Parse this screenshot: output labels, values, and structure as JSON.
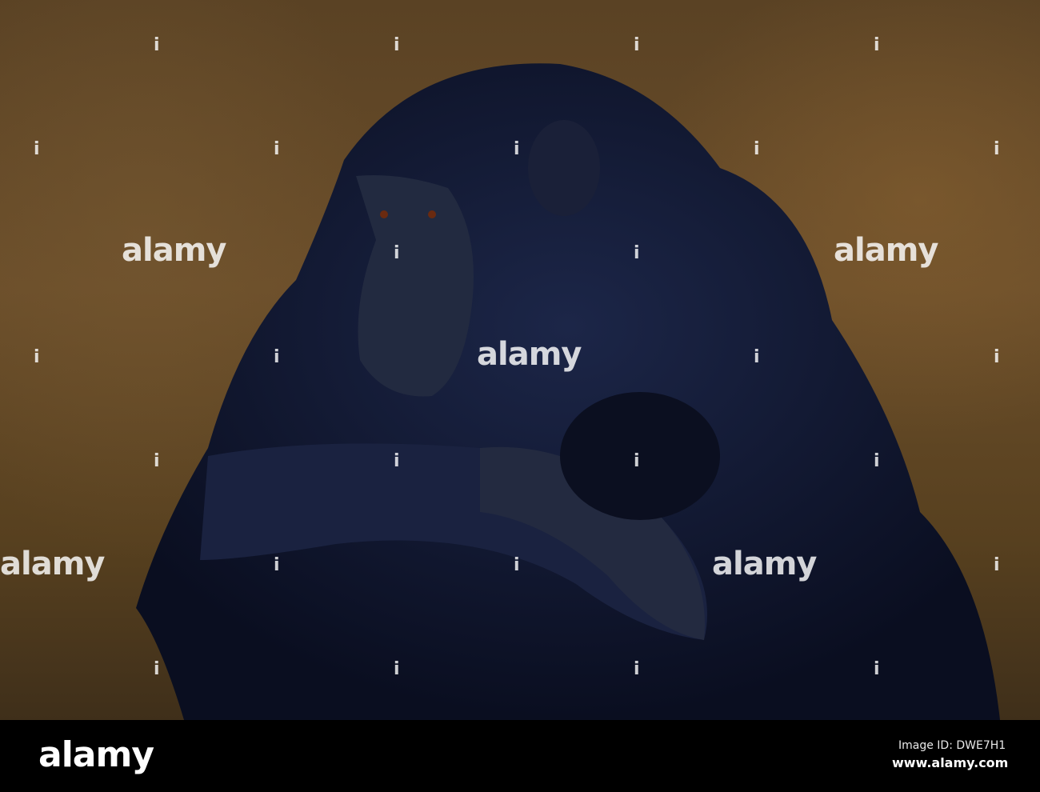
{
  "watermark": {
    "text": "alamy",
    "dot": "i"
  },
  "footer": {
    "logo": "alamy",
    "image_id": "Image ID: DWE7H1",
    "url": "www.alamy.com"
  },
  "colors": {
    "background": "#5a4224",
    "fur": "#10162e",
    "bar": "#000000"
  }
}
